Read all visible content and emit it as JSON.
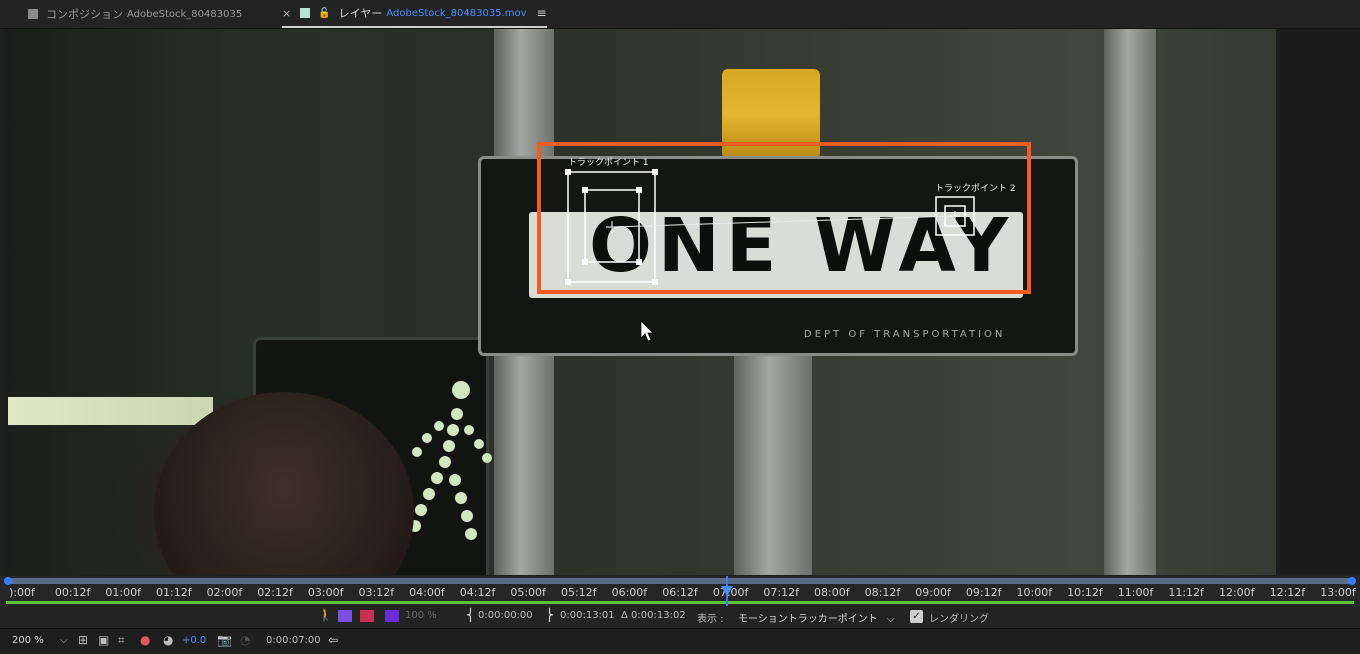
{
  "tabs": {
    "composition": {
      "label": "コンポジション",
      "name": "AdobeStock_80483035"
    },
    "layer": {
      "close": "×",
      "label": "レイヤー",
      "name": "AdobeStock_80483035.mov",
      "menu": "≡"
    }
  },
  "footage": {
    "sign_text": "ONE WAY",
    "sign_subtext": "DEPT OF TRANSPORTATION"
  },
  "tracker": {
    "point1_label": "トラックポイント 1",
    "point2_label": "トラックポイント 2",
    "highlight_color": "#f25c21"
  },
  "timeline": {
    "ticks": [
      "):00f",
      "00:12f",
      "01:00f",
      "01:12f",
      "02:00f",
      "02:12f",
      "03:00f",
      "03:12f",
      "04:00f",
      "04:12f",
      "05:00f",
      "05:12f",
      "06:00f",
      "06:12f",
      "07:00f",
      "07:12f",
      "08:00f",
      "08:12f",
      "09:00f",
      "09:12f",
      "10:00f",
      "10:12f",
      "11:00f",
      "11:12f",
      "12:00f",
      "12:12f",
      "13:00f"
    ],
    "accent": "#3a7bff",
    "work_area_color": "#5cc43a"
  },
  "controls": {
    "opacity": "100 %",
    "in_point": "0:00:00:00",
    "out_point": "0:00:13:01",
    "duration": "Δ 0:00:13:02",
    "view_label": "表示 :",
    "view_value": "モーショントラッカーポイント",
    "render_label": "レンダリング"
  },
  "bottom": {
    "zoom": "200 %",
    "exposure": "+0.0",
    "timecode": "0:00:07:00"
  }
}
